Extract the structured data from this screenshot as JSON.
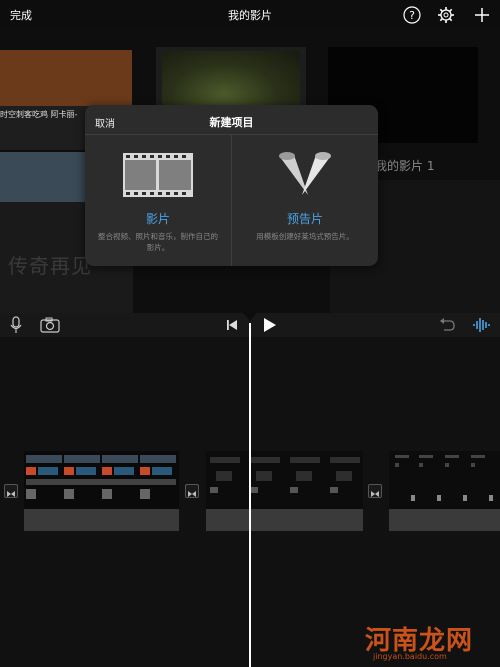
{
  "topbar": {
    "done_label": "完成",
    "title": "我的影片",
    "help_icon": "help-icon",
    "settings_icon": "gear-icon",
    "add_icon": "plus-icon"
  },
  "browser": {
    "project_caption": "时空刺客吃鸡 阿卡丽-",
    "legend_title": "传奇再见",
    "movie_label": "我的影片 1"
  },
  "popover": {
    "cancel_label": "取消",
    "title": "新建项目",
    "movie": {
      "label": "影片",
      "description": "整合视频、照片和音乐，制作自己的影片。",
      "icon": "filmstrip-icon"
    },
    "trailer": {
      "label": "预告片",
      "description": "用模板创建好莱坞式预告片。",
      "icon": "spotlights-icon"
    }
  },
  "toolbar": {
    "mic_icon": "microphone-icon",
    "camera_icon": "camera-icon",
    "skip_start_icon": "skip-to-start-icon",
    "play_icon": "play-icon",
    "undo_icon": "undo-icon",
    "audio_icon": "audio-waveform-icon"
  },
  "watermark": {
    "text": "河南龙网",
    "domain": "jingyan.baidu.com"
  },
  "colors": {
    "accent": "#4aa3e8",
    "popover_bg": "#2c2c2c",
    "background": "#000000"
  }
}
